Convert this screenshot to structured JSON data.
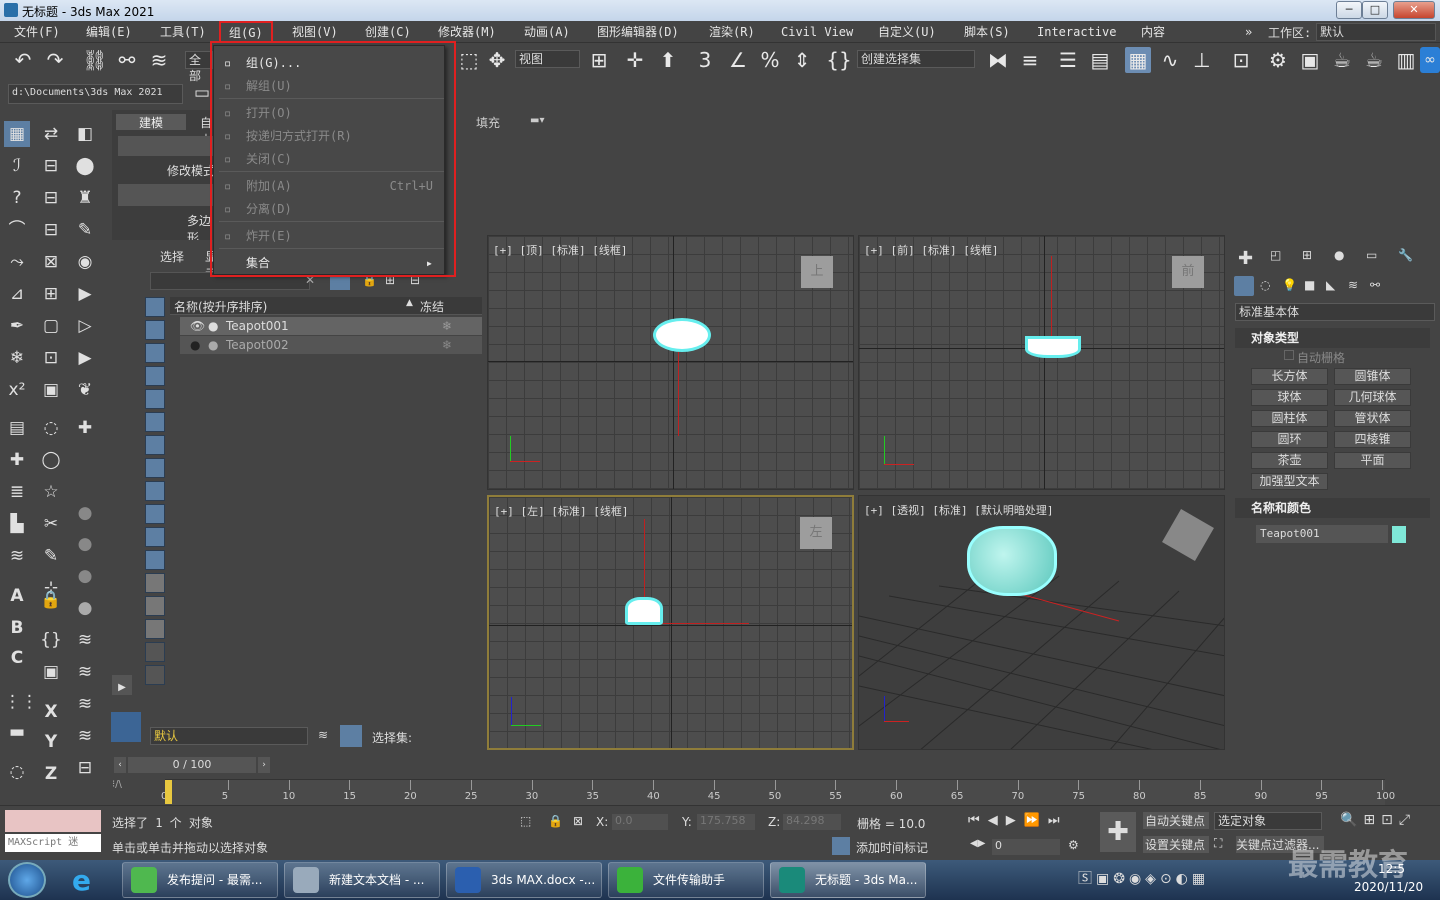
{
  "window": {
    "title": "无标题 - 3ds Max 2021",
    "minimize": "─",
    "maximize": "□",
    "close": "✕"
  },
  "menubar": {
    "items": [
      "文件(F)",
      "编辑(E)",
      "工具(T)",
      "组(G)",
      "视图(V)",
      "创建(C)",
      "修改器(M)",
      "动画(A)",
      "图形编辑器(D)",
      "渲染(R)",
      "Civil View",
      "自定义(U)",
      "脚本(S)",
      "Interactive",
      "内容"
    ],
    "workspace_label": "工作区:",
    "workspace_value": "默认"
  },
  "group_menu": {
    "items": [
      {
        "label": "组(G)...",
        "enabled": true,
        "shortcut": ""
      },
      {
        "label": "解组(U)",
        "enabled": false,
        "shortcut": ""
      },
      {
        "label": "打开(O)",
        "enabled": false,
        "shortcut": ""
      },
      {
        "label": "按递归方式打开(R)",
        "enabled": false,
        "shortcut": ""
      },
      {
        "label": "关闭(C)",
        "enabled": false,
        "shortcut": ""
      },
      {
        "label": "附加(A)",
        "enabled": false,
        "shortcut": "Ctrl+U"
      },
      {
        "label": "分离(D)",
        "enabled": false,
        "shortcut": ""
      },
      {
        "label": "炸开(E)",
        "enabled": false,
        "shortcut": ""
      },
      {
        "label": "集合",
        "enabled": true,
        "shortcut": "▸"
      }
    ]
  },
  "toolbar": {
    "filter": "全部",
    "view": "视图",
    "selection_set": "创建选择集"
  },
  "path": "d:\\Documents\\3ds Max 2021",
  "ribbon": {
    "tab_modeling": "建模",
    "tab_free": "自由",
    "modify_mode": "修改模式",
    "polygon": "多边形",
    "fill": "填充"
  },
  "scene_explorer": {
    "tab_select": "选择",
    "tab_display": "显示",
    "col_name": "名称(按升序排序)",
    "col_frozen": "冻结",
    "rows": [
      "Teapot001",
      "Teapot002"
    ],
    "layer": "默认",
    "selection_set_label": "选择集:"
  },
  "viewports": [
    {
      "label": "[+] [顶] [标准] [线框]",
      "cube": "上"
    },
    {
      "label": "[+] [前] [标准] [线框]",
      "cube": "前"
    },
    {
      "label": "[+] [左] [标准] [线框]",
      "cube": "左"
    },
    {
      "label": "[+] [透视] [标准] [默认明暗处理]",
      "cube": ""
    }
  ],
  "command_panel": {
    "category": "标准基本体",
    "object_type": "对象类型",
    "autogrid": "自动栅格",
    "buttons": [
      "长方体",
      "圆锥体",
      "球体",
      "几何球体",
      "圆柱体",
      "管状体",
      "圆环",
      "四棱锥",
      "茶壶",
      "平面",
      "加强型文本"
    ],
    "name_color": "名称和颜色",
    "object_name": "Teapot001",
    "object_color": "#7fe8d8"
  },
  "timeline": {
    "frame": "0 / 100",
    "ticks": [
      "0",
      "5",
      "10",
      "15",
      "20",
      "25",
      "30",
      "35",
      "40",
      "45",
      "50",
      "55",
      "60",
      "65",
      "70",
      "75",
      "80",
      "85",
      "90",
      "95",
      "100"
    ]
  },
  "status": {
    "maxscript": "MAXScript 迷",
    "selected": "选择了 1 个 对象",
    "hint": "单击或单击并拖动以选择对象",
    "x_label": "X:",
    "x": "0.0",
    "y_label": "Y:",
    "y": "175.758",
    "z_label": "Z:",
    "z": "84.298",
    "grid": "栅格 = 10.0",
    "add_time_tag": "添加时间标记",
    "auto_key": "自动关键点",
    "selected_object": "选定对象",
    "set_key": "设置关键点",
    "key_filter": "关键点过滤器...",
    "frame_spin": "0"
  },
  "taskbar": {
    "tasks": [
      "发布提问 - 最需...",
      "新建文本文档 - ...",
      "3ds MAX.docx -...",
      "文件传输助手",
      "无标题 - 3ds Ma..."
    ],
    "date": "2020/11/20",
    "time": "12:5",
    "watermark": "最需教育"
  }
}
